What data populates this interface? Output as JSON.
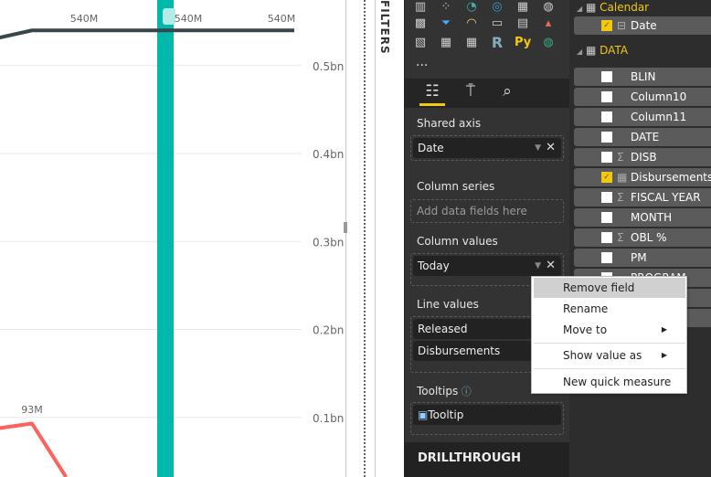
{
  "chart_data": {
    "type": "bar+line",
    "y_ticks": [
      "0.5bn",
      "0.4bn",
      "0.3bn",
      "0.2bn",
      "0.1bn"
    ],
    "y_tick_values": [
      0.5,
      0.4,
      0.3,
      0.2,
      0.1
    ],
    "ylim": [
      0,
      0.58
    ],
    "grid": true,
    "columns": [
      {
        "value": 0.9
      }
    ],
    "lines": [
      {
        "color": "#374649",
        "values": [
          0.525,
          0.54,
          0.54,
          0.54,
          0.54
        ],
        "labels": [
          "",
          "",
          "540M",
          "540M",
          "540M"
        ]
      },
      {
        "color": "#fd625e",
        "values": [
          0.082,
          0.093,
          0
        ],
        "labels": [
          "",
          "93M",
          ""
        ]
      }
    ],
    "column_color": "#01b8aa"
  },
  "filters": {
    "label": "FILTERS"
  },
  "viz": {
    "more": "...",
    "tabs": [
      "fields-icon",
      "format-paint-icon",
      "analytics-icon"
    ],
    "shared_axis": {
      "label": "Shared axis",
      "value": "Date"
    },
    "column_series": {
      "label": "Column series",
      "placeholder": "Add data fields here"
    },
    "column_values": {
      "label": "Column values",
      "value": "Today"
    },
    "line_values": {
      "label": "Line values",
      "items": [
        "Released",
        "Disbursements"
      ]
    },
    "tooltips": {
      "label": "Tooltips",
      "value": "Tooltip"
    },
    "drillthrough": "DRILLTHROUGH"
  },
  "fields": {
    "tables": [
      {
        "name": "Calendar"
      },
      {
        "name": "DATA"
      }
    ],
    "calendar_items": [
      {
        "name": "Date",
        "checked": true
      }
    ],
    "items": [
      {
        "name": "BLIN",
        "sigma": false,
        "checked": false
      },
      {
        "name": "Column10",
        "sigma": false,
        "checked": false
      },
      {
        "name": "Column11",
        "sigma": false,
        "checked": false
      },
      {
        "name": "DATE",
        "sigma": false,
        "checked": false
      },
      {
        "name": "DISB",
        "sigma": true,
        "checked": false
      },
      {
        "name": "Disbursements",
        "sigma": false,
        "measure": true,
        "checked": true
      },
      {
        "name": "FISCAL YEAR",
        "sigma": true,
        "checked": false
      },
      {
        "name": "MONTH",
        "sigma": false,
        "checked": false
      },
      {
        "name": "OBL %",
        "sigma": true,
        "checked": false
      },
      {
        "name": "PM",
        "sigma": false,
        "checked": false
      },
      {
        "name": "PROGRAM",
        "sigma": false,
        "checked": false
      },
      {
        "name": "",
        "sigma": false,
        "checked": false
      },
      {
        "name": "VAL...",
        "sigma": false,
        "checked": false
      }
    ]
  },
  "context_menu": {
    "items": [
      "Remove field",
      "Rename",
      "Move to",
      "Show value as",
      "New quick measure"
    ]
  },
  "colors": {
    "accent": "#f2c811",
    "teal": "#01b8aa",
    "panel": "#333333"
  }
}
